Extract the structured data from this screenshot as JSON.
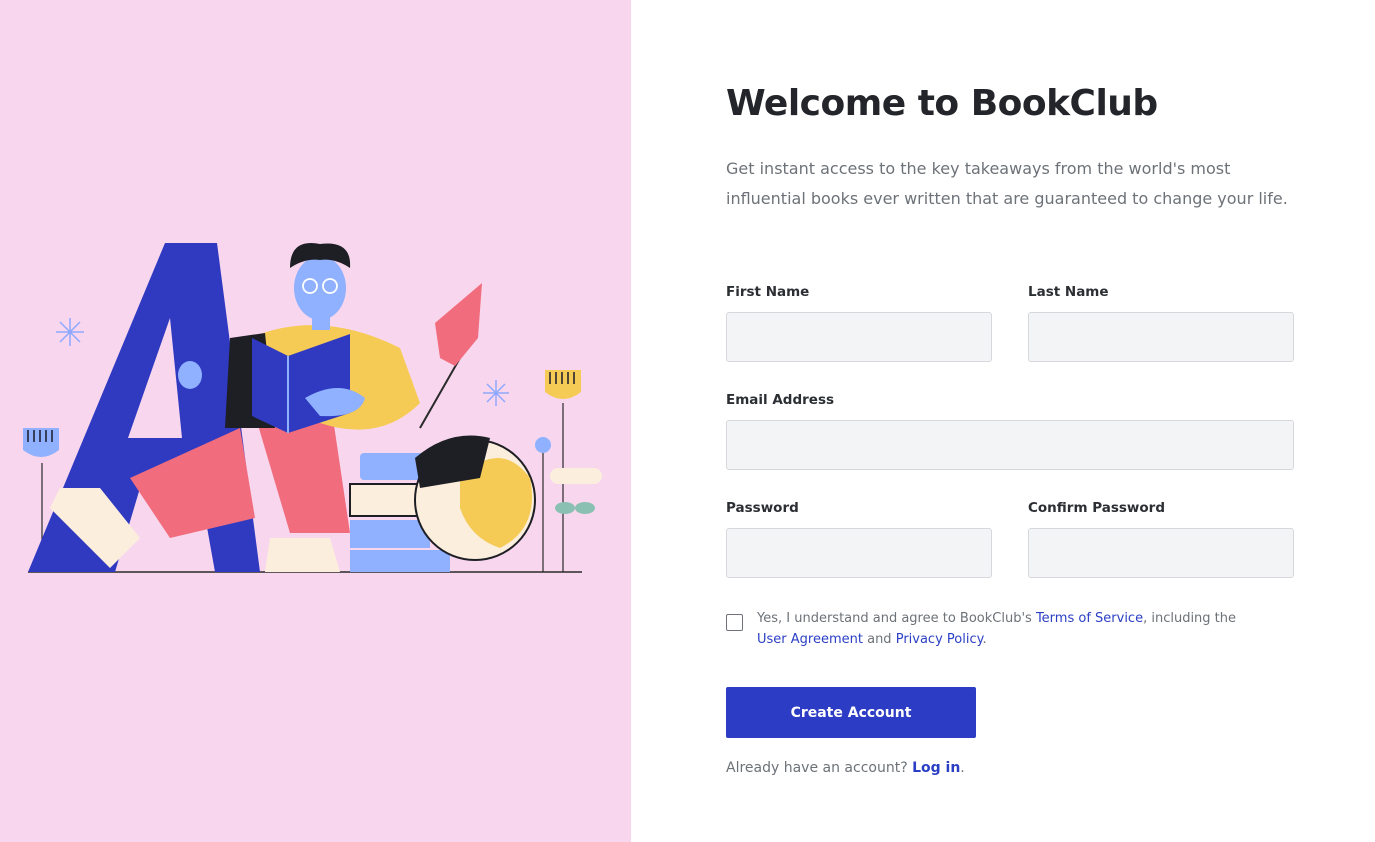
{
  "hero": {
    "title": "Welcome to BookClub",
    "subtitle": "Get instant access to the key takeaways from the world's most influential books ever written that are guaranteed to change your life."
  },
  "form": {
    "first_name": {
      "label": "First Name",
      "value": "",
      "placeholder": ""
    },
    "last_name": {
      "label": "Last Name",
      "value": "",
      "placeholder": ""
    },
    "email": {
      "label": "Email Address",
      "value": "",
      "placeholder": ""
    },
    "password": {
      "label": "Password",
      "value": "",
      "placeholder": ""
    },
    "confirm_password": {
      "label": "Confirm Password",
      "value": "",
      "placeholder": ""
    },
    "consent": {
      "checked": false,
      "text_before": "Yes, I understand and agree to BookClub's ",
      "terms_link": "Terms of Service",
      "text_middle": ", including the ",
      "agreement_link": "User Agreement",
      "text_and": " and ",
      "privacy_link": "Privacy Policy",
      "text_end": "."
    },
    "submit_label": "Create Account"
  },
  "footer": {
    "prompt": "Already have an account? ",
    "login_link": "Log in",
    "period": "."
  },
  "colors": {
    "left_panel_bg": "#f8d7ee",
    "primary": "#2d3cc4",
    "link": "#2b3fc5",
    "input_bg": "#f3f4f6"
  }
}
